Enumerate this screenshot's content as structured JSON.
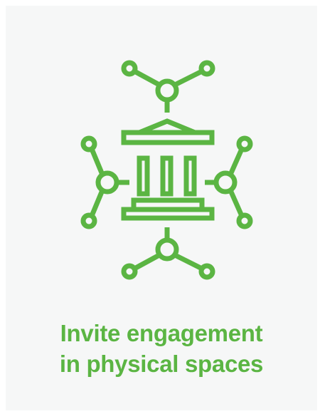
{
  "card": {
    "icon": "museum-network-icon",
    "title_line_1": "Invite engagement",
    "title_line_2": "in physical spaces"
  },
  "colors": {
    "accent": "#5bb543",
    "background": "#f6f7f7"
  }
}
